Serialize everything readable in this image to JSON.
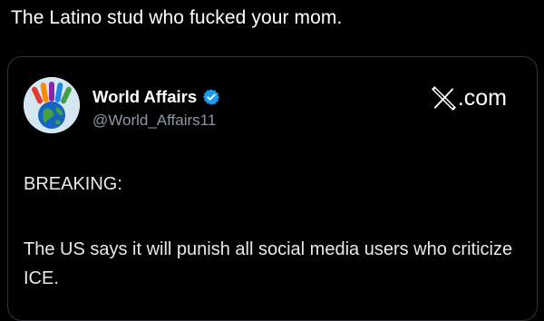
{
  "caption": "The Latino stud who fucked your mom.",
  "post": {
    "author": {
      "name": "World Affairs",
      "handle": "@World_Affairs11",
      "verified": true,
      "avatar_icon": "globe-hands-icon"
    },
    "source_suffix": ".com",
    "source_logo_icon": "x-logo-icon",
    "headline": "BREAKING:",
    "body": "The US says it will punish all social media users who criticize ICE."
  },
  "colors": {
    "background": "#000000",
    "text": "#e7e9ea",
    "muted": "#8b98a5",
    "verified": "#1d9bf0",
    "card_border": "#2f3336"
  }
}
